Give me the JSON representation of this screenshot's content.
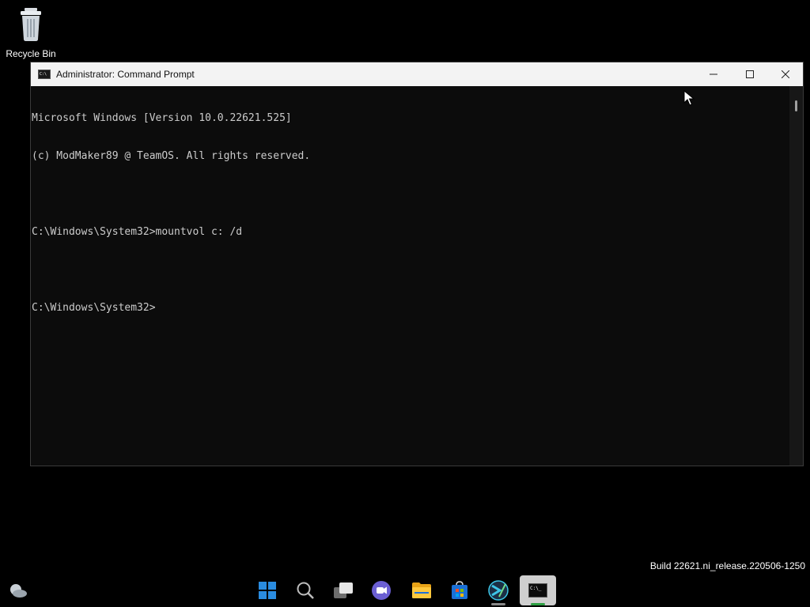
{
  "desktop": {
    "recycle_bin_label": "Recycle Bin",
    "build_watermark": "Build 22621.ni_release.220506-1250"
  },
  "window": {
    "title": "Administrator: Command Prompt",
    "console_lines": [
      "Microsoft Windows [Version 10.0.22621.525]",
      "(c) ModMaker89 @ TeamOS. All rights reserved.",
      "",
      "C:\\Windows\\System32>mountvol c: /d",
      "",
      "C:\\Windows\\System32>"
    ]
  },
  "taskbar": {
    "items": [
      {
        "name": "start-button",
        "icon": "windows-logo-icon"
      },
      {
        "name": "search-button",
        "icon": "search-icon"
      },
      {
        "name": "task-view-button",
        "icon": "task-view-icon"
      },
      {
        "name": "chat-button",
        "icon": "chat-icon"
      },
      {
        "name": "file-explorer-button",
        "icon": "folder-icon"
      },
      {
        "name": "store-button",
        "icon": "store-icon"
      },
      {
        "name": "app-button",
        "icon": "app-icon"
      },
      {
        "name": "command-prompt-button",
        "icon": "cmd-icon",
        "active": true
      }
    ]
  },
  "colors": {
    "console_bg": "#0c0c0c",
    "console_text": "#cccccc",
    "titlebar_bg": "#f3f3f3",
    "active_indicator": "#2ea043"
  }
}
